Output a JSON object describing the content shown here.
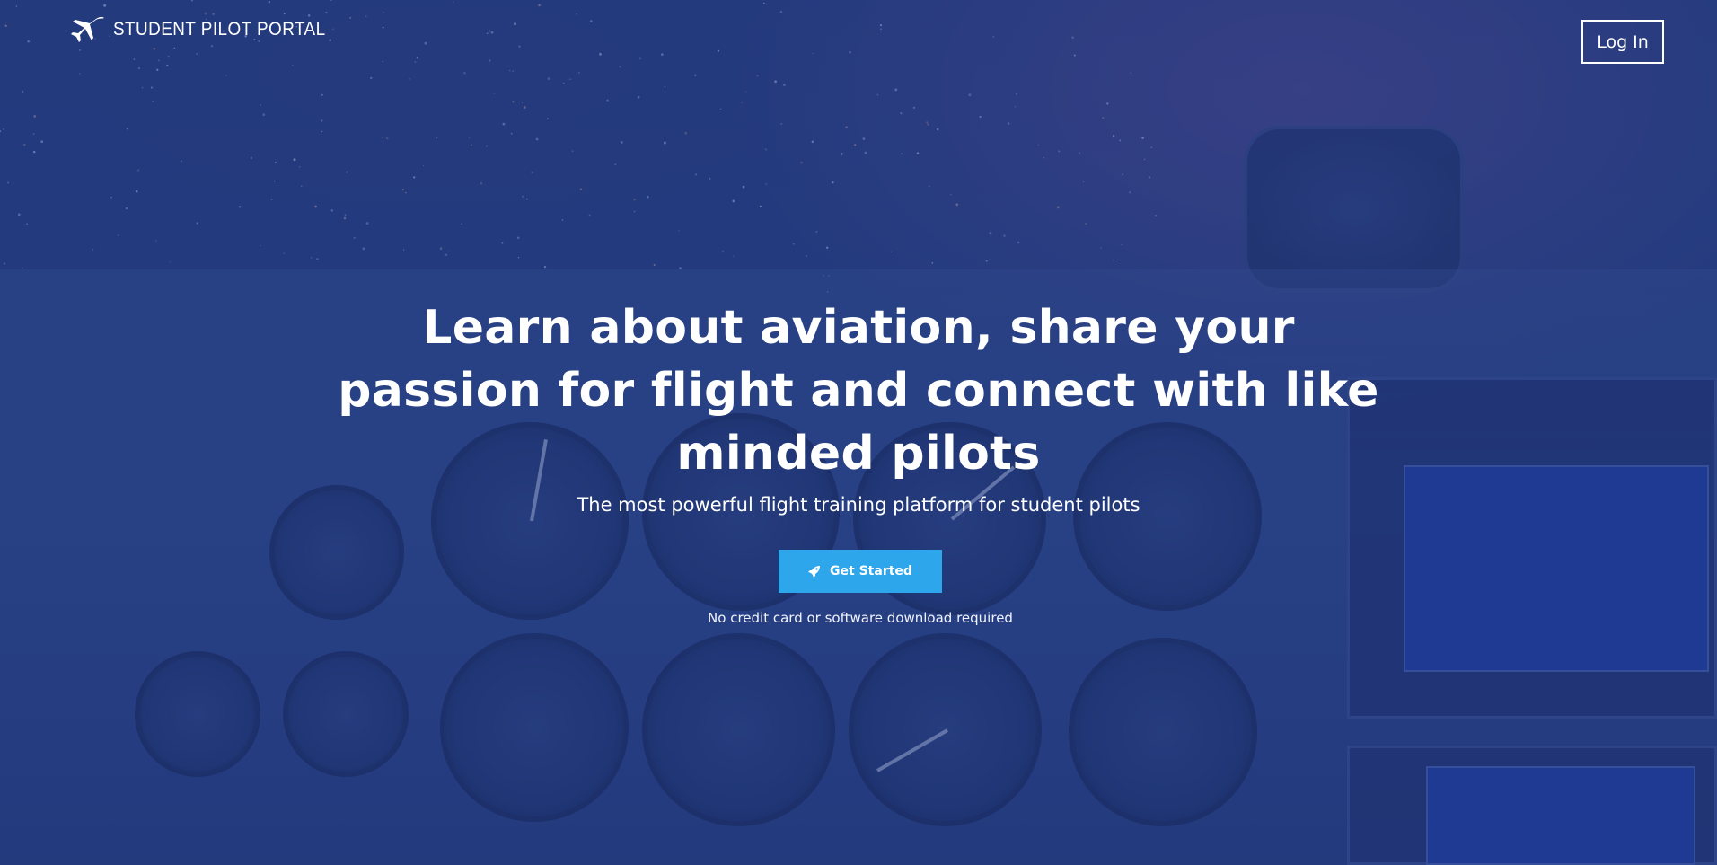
{
  "header": {
    "brand": "STUDENT PILOT PORTAL",
    "brand_icon": "airplane-icon",
    "login_label": "Log In"
  },
  "hero": {
    "title": "Learn about aviation, share your passion for flight and connect with like minded pilots",
    "subtitle": "The most powerful flight training platform for student pilots",
    "cta_label": "Get Started",
    "cta_icon": "rocket-icon",
    "note": "No credit card or software download required"
  },
  "colors": {
    "overlay": "#233a82",
    "cta": "#2ea6ec",
    "text": "#ffffff"
  }
}
